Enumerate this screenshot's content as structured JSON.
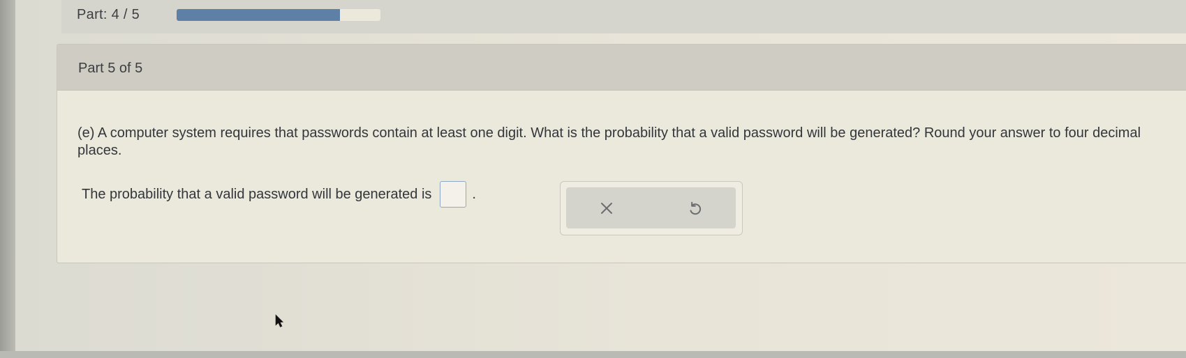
{
  "progress": {
    "label": "Part: 4 / 5",
    "fraction": 0.8
  },
  "card": {
    "part_label": "Part 5 of 5",
    "question_text": "(e) A computer system requires that passwords contain at least one digit. What is the probability that a valid password will be generated? Round your answer to four decimal places.",
    "answer_prompt": "The probability that a valid password will be generated is",
    "answer_value": "",
    "answer_suffix": "."
  },
  "tools": {
    "clear_icon": "close-icon",
    "undo_icon": "undo-icon"
  },
  "colors": {
    "progress_fill": "#5e7fa6",
    "answer_border": "#8fa8c4"
  }
}
